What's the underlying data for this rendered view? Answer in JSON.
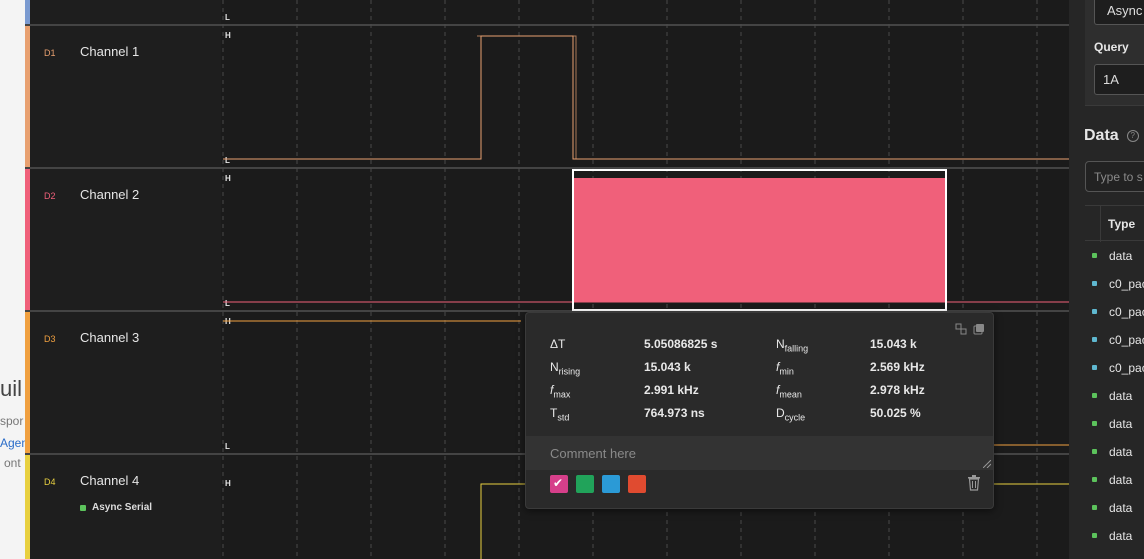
{
  "background_window": {
    "heading_fragment": "uil",
    "text_fragment_1": "spor",
    "link_fragment": "Agen",
    "text_fragment_2": "ont"
  },
  "channels": [
    {
      "id": "D1",
      "name": "Channel 1",
      "color": "#e8a070",
      "level_high": "H",
      "level_low": "L",
      "sub": ""
    },
    {
      "id": "D2",
      "name": "Channel 2",
      "color": "#f0607a",
      "level_high": "H",
      "level_low": "L",
      "sub": ""
    },
    {
      "id": "D3",
      "name": "Channel 3",
      "color": "#f0a040",
      "level_high": "H",
      "level_low": "L",
      "sub": ""
    },
    {
      "id": "D4",
      "name": "Channel 4",
      "color": "#e8d040",
      "level_high": "H",
      "level_low": "",
      "sub": "Async Serial"
    }
  ],
  "top_partial_low": "L",
  "measurement": {
    "rows": [
      {
        "k1": "ΔT",
        "k1_sub": "",
        "v1": "5.05086825 s",
        "k2": "N",
        "k2_sub": "falling",
        "v2": "15.043 k"
      },
      {
        "k1": "N",
        "k1_sub": "rising",
        "v1": "15.043 k",
        "k2": "f",
        "k2_sub": "min",
        "v2": "2.569 kHz"
      },
      {
        "k1": "f",
        "k1_sub": "max",
        "v1": "2.991 kHz",
        "k2": "f",
        "k2_sub": "mean",
        "v2": "2.978 kHz"
      },
      {
        "k1": "T",
        "k1_sub": "std",
        "v1": "764.973 ns",
        "k2": "D",
        "k2_sub": "cycle",
        "v2": "50.025 %"
      }
    ],
    "comment_placeholder": "Comment here",
    "swatches": [
      "#d63f8a",
      "#21a35a",
      "#2b9ad6",
      "#e04b30"
    ],
    "selected_swatch": 0
  },
  "sidebar": {
    "analyzer_select": "Async",
    "query_label": "Query",
    "query_value": "1A",
    "data_title": "Data",
    "search_placeholder": "Type to s",
    "table_header": "Type",
    "rows": [
      {
        "type": "data",
        "color": "#5cc35c"
      },
      {
        "type": "c0_pac",
        "color": "#5fb8d0"
      },
      {
        "type": "c0_pac",
        "color": "#5fb8d0"
      },
      {
        "type": "c0_pac",
        "color": "#5fb8d0"
      },
      {
        "type": "c0_pac",
        "color": "#5fb8d0"
      },
      {
        "type": "data",
        "color": "#5cc35c"
      },
      {
        "type": "data",
        "color": "#5cc35c"
      },
      {
        "type": "data",
        "color": "#5cc35c"
      },
      {
        "type": "data",
        "color": "#5cc35c"
      },
      {
        "type": "data",
        "color": "#5cc35c"
      },
      {
        "type": "data",
        "color": "#5cc35c"
      }
    ]
  }
}
